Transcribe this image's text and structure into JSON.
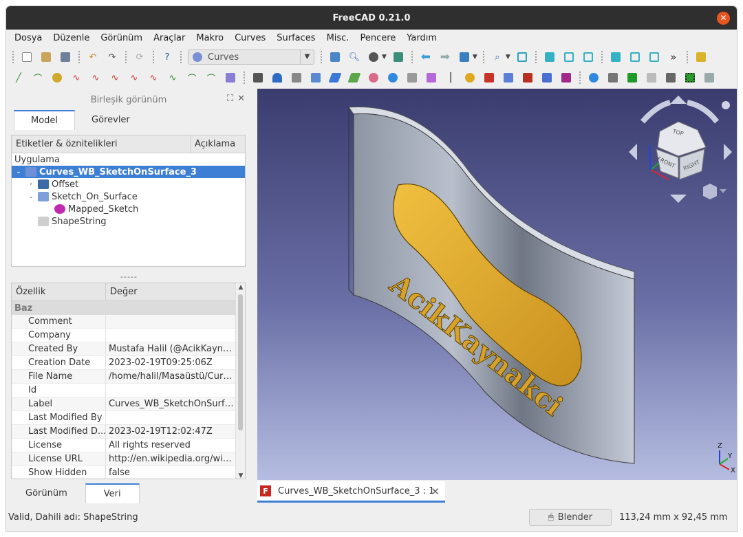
{
  "window": {
    "title": "FreeCAD 0.21.0"
  },
  "menu": [
    {
      "label": "Dosya"
    },
    {
      "label": "Düzenle"
    },
    {
      "label": "Görünüm"
    },
    {
      "label": "Araçlar"
    },
    {
      "label": "Makro"
    },
    {
      "label": "Curves"
    },
    {
      "label": "Surfaces"
    },
    {
      "label": "Misc."
    },
    {
      "label": "Pencere"
    },
    {
      "label": "Yardım"
    }
  ],
  "toolbar": {
    "workbench_selected": "Curves",
    "more_label": "»"
  },
  "colors": {
    "accent": "#3d7fd4",
    "close": "#e95420",
    "part": "#d9a72a",
    "surface": "#a3acbb"
  },
  "combo_view": {
    "title": "Birleşik görünüm",
    "tabs": [
      {
        "label": "Model"
      },
      {
        "label": "Görevler"
      }
    ],
    "tree": {
      "col_labels": "Etiketler & öznitelikleri",
      "col_desc": "Açıklama",
      "root_label": "Uygulama",
      "items": [
        {
          "label": "Curves_WB_SketchOnSurface_3",
          "icon": "document-icon"
        },
        {
          "label": "Offset",
          "icon": "offset-icon"
        },
        {
          "label": "Sketch_On_Surface",
          "icon": "sketch-on-surface-icon"
        },
        {
          "label": "Mapped_Sketch",
          "icon": "mapped-sketch-icon"
        },
        {
          "label": "ShapeString",
          "icon": "shapestring-icon"
        }
      ]
    },
    "splitter": "-----",
    "props": {
      "col_prop": "Özellik",
      "col_value": "Değer",
      "group": "Baz",
      "rows": [
        {
          "key": "Comment",
          "value": ""
        },
        {
          "key": "Company",
          "value": ""
        },
        {
          "key": "Created By",
          "value": "Mustafa Halil (@AcikKaynak..."
        },
        {
          "key": "Creation Date",
          "value": "2023-02-19T09:25:06Z"
        },
        {
          "key": "File Name",
          "value": "/home/halil/Masaüstü/Curve..."
        },
        {
          "key": "Id",
          "value": ""
        },
        {
          "key": "Label",
          "value": "Curves_WB_SketchOnSurfa..."
        },
        {
          "key": "Last Modified By",
          "value": ""
        },
        {
          "key": "Last Modified D...",
          "value": "2023-02-19T12:02:47Z"
        },
        {
          "key": "License",
          "value": "All rights reserved"
        },
        {
          "key": "License URL",
          "value": "http://en.wikipedia.org/wiki/..."
        },
        {
          "key": "Show Hidden",
          "value": "false"
        }
      ]
    },
    "bottom_tabs": [
      {
        "label": "Görünüm"
      },
      {
        "label": "Veri"
      }
    ]
  },
  "viewport": {
    "text_3d": "AcikKaynakci",
    "navcube": {
      "top": "TOP",
      "front": "FRONT",
      "right": "RIGHT"
    },
    "axes": {
      "x": "X",
      "y": "Y",
      "z": "Z"
    }
  },
  "doc_tab": {
    "label": "Curves_WB_SketchOnSurface_3 : 1",
    "icon_letter": "F"
  },
  "status": {
    "text": "Valid, Dahili adı: ShapeString",
    "nav_style": "Blender",
    "dimensions": "113,24 mm x 92,45 mm"
  }
}
